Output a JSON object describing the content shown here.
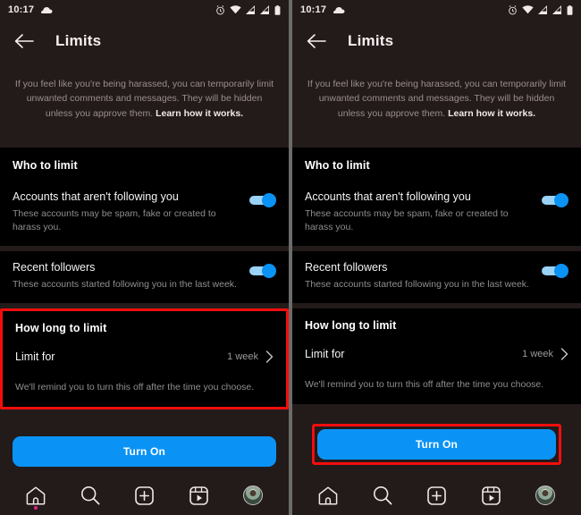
{
  "meta": {
    "panel_count": 2,
    "highlight_color": "#f40d0d",
    "accent_color": "#0a93f5",
    "page_background": "#231a1a",
    "card_background": "#000000"
  },
  "status_bar": {
    "time": "10:17",
    "icons": [
      "cloud-icon",
      "alarm-icon",
      "wifi-icon",
      "signal-icon",
      "signal-icon",
      "battery-icon"
    ]
  },
  "app_bar": {
    "back_label": "Back",
    "title": "Limits"
  },
  "intro": {
    "text": "If you feel like you're being harassed, you can temporarily limit unwanted comments and messages. They will be hidden unless you approve them. ",
    "link_text": "Learn how it works."
  },
  "who_to_limit": {
    "section_title": "Who to limit",
    "rows": [
      {
        "title": "Accounts that aren't following you",
        "subtitle": "These accounts may be spam, fake or created to harass you.",
        "toggle_on": true
      },
      {
        "title": "Recent followers",
        "subtitle": "These accounts started following you in the last week.",
        "toggle_on": true
      }
    ]
  },
  "how_long_to_limit": {
    "section_title": "How long to limit",
    "limit_for_label": "Limit for",
    "limit_for_value": "1 week",
    "chevron": "chevron-right-icon",
    "note": "We'll remind you to turn this off after the time you choose."
  },
  "cta": {
    "label": "Turn On"
  },
  "bottom_nav": {
    "items": [
      {
        "name": "home",
        "icon": "home-icon",
        "has_dot": true
      },
      {
        "name": "search",
        "icon": "search-icon",
        "has_dot": false
      },
      {
        "name": "create",
        "icon": "plus-square-icon",
        "has_dot": false
      },
      {
        "name": "reels",
        "icon": "reels-icon",
        "has_dot": false
      },
      {
        "name": "profile",
        "icon": "avatar-icon",
        "has_dot": false
      }
    ]
  },
  "panels": [
    {
      "id": "left",
      "highlighted_region": "how-long-to-limit-card"
    },
    {
      "id": "right",
      "highlighted_region": "turn-on-button"
    }
  ]
}
